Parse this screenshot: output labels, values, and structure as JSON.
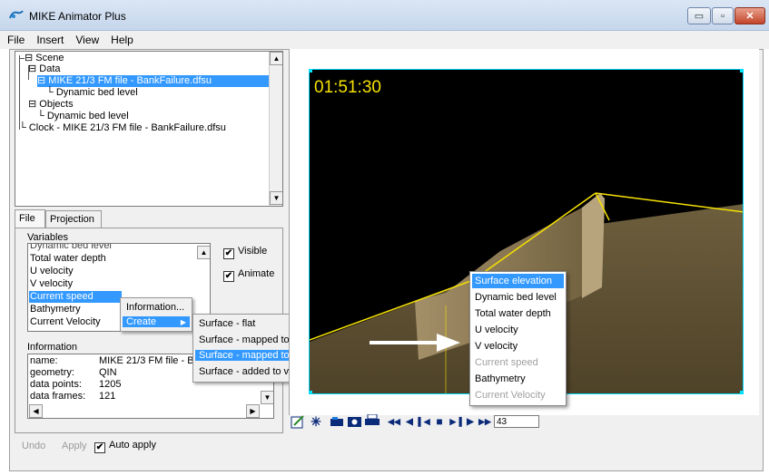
{
  "window": {
    "title": "MIKE Animator Plus",
    "min_glyph": "▭",
    "max_glyph": "▫",
    "close_glyph": "✕"
  },
  "menu": [
    "File",
    "Insert",
    "View",
    "Help"
  ],
  "tree": {
    "items": [
      "Scene",
      "Data",
      "MIKE 21/3 FM file - BankFailure.dfsu",
      "Dynamic bed level",
      "Objects",
      "Dynamic bed level",
      "Clock - MIKE 21/3 FM file - BankFailure.dfsu"
    ]
  },
  "tabs": [
    "File",
    "Projection"
  ],
  "variables": {
    "label": "Variables",
    "items": [
      "Dynamic bed level",
      "Total water depth",
      "U velocity",
      "V velocity",
      "Current speed",
      "Bathymetry",
      "Current Velocity"
    ],
    "selected": "Current speed",
    "visible_label": "Visible",
    "animate_label": "Animate",
    "check_glyph": "✔"
  },
  "context_menu": {
    "items": [
      "Information...",
      "Create"
    ],
    "arrow": "▶"
  },
  "submenu": {
    "items": [
      "Surface - flat",
      "Surface - mapped to magnitude",
      "Surface - mapped to variable...",
      "Surface - added to variable..."
    ]
  },
  "information": {
    "label": "Information",
    "rows": [
      {
        "key": "name:",
        "value": "MIKE 21/3 FM file - B"
      },
      {
        "key": "geometry:",
        "value": "QIN"
      },
      {
        "key": "data points:",
        "value": "1205"
      },
      {
        "key": "data frames:",
        "value": "121"
      }
    ]
  },
  "bottom": {
    "undo": "Undo",
    "apply": "Apply",
    "auto_apply": "Auto apply"
  },
  "viewport": {
    "clock": "01:51:30"
  },
  "variable_popup": {
    "items": [
      "Surface elevation",
      "Dynamic bed level",
      "Total water depth",
      "U velocity",
      "V velocity",
      "Current speed",
      "Bathymetry",
      "Current Velocity"
    ]
  },
  "toolbar": {
    "frame_value": "43",
    "icons": [
      "edit-icon",
      "star-icon",
      "camera-icon",
      "photo-icon",
      "print-icon",
      "rewind-icon",
      "step-back-icon",
      "start-icon",
      "stop-icon",
      "end-icon",
      "step-forward-icon",
      "fast-forward-icon"
    ],
    "glyphs": {
      "rewind": "◀◀",
      "step_back": "◀",
      "start": "▌◀",
      "stop": "■",
      "end": "▶▐",
      "step_forward": "▶",
      "fast_forward": "▶▶"
    }
  },
  "colors": {
    "accent": "#3399ff",
    "clock": "#f5e100",
    "viewport_border": "#00d8ff"
  }
}
